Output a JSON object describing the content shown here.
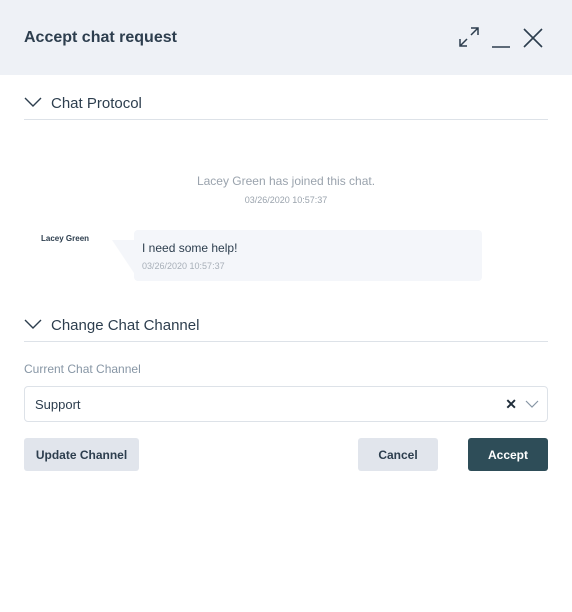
{
  "header": {
    "title": "Accept chat request"
  },
  "protocol": {
    "section_label": "Chat Protocol",
    "system_message": "Lacey Green has joined this chat.",
    "system_timestamp": "03/26/2020 10:57:37",
    "messages": [
      {
        "author": "Lacey Green",
        "text": "I need some help!",
        "timestamp": "03/26/2020 10:57:37"
      }
    ]
  },
  "channel": {
    "section_label": "Change Chat Channel",
    "field_label": "Current Chat Channel",
    "selected": "Support",
    "clear_glyph": "✕"
  },
  "buttons": {
    "update": "Update Channel",
    "cancel": "Cancel",
    "accept": "Accept"
  }
}
